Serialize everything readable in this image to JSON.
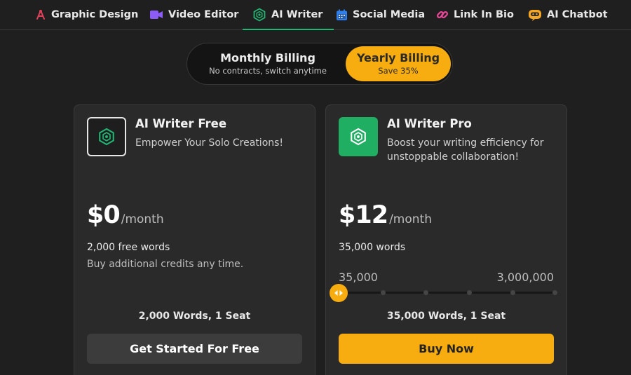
{
  "nav": {
    "items": [
      {
        "label": "Graphic Design",
        "icon": "graphic-design-icon",
        "active": false
      },
      {
        "label": "Video Editor",
        "icon": "video-camera-icon",
        "active": false
      },
      {
        "label": "AI Writer",
        "icon": "ai-writer-icon",
        "active": true
      },
      {
        "label": "Social Media",
        "icon": "calendar-icon",
        "active": false
      },
      {
        "label": "Link In Bio",
        "icon": "link-icon",
        "active": false
      },
      {
        "label": "AI Chatbot",
        "icon": "chatbot-icon",
        "active": false
      }
    ]
  },
  "billing": {
    "monthly": {
      "title": "Monthly Billing",
      "subtitle": "No contracts, switch anytime"
    },
    "yearly": {
      "title": "Yearly Billing",
      "subtitle": "Save 35%"
    },
    "selected": "yearly"
  },
  "plans": {
    "free": {
      "icon": "ai-writer-icon",
      "name": "AI Writer Free",
      "description": "Empower Your Solo Creations!",
      "price": "$0",
      "period": "/month",
      "words": "2,000 free words",
      "note": "Buy additional credits any time.",
      "seats": "2,000 Words, 1 Seat",
      "cta": "Get Started For Free"
    },
    "pro": {
      "icon": "ai-writer-icon",
      "name": "AI Writer Pro",
      "description": "Boost your writing efficiency for unstoppable collaboration!",
      "price": "$12",
      "period": "/month",
      "words": "35,000 words",
      "slider": {
        "min_label": "35,000",
        "max_label": "3,000,000",
        "value_fraction": 0
      },
      "seats": "35,000 Words, 1 Seat",
      "cta": "Buy Now"
    }
  },
  "colors": {
    "accent": "#f7ac0f",
    "active_underline": "#22b573",
    "pro_icon_bg": "#1fae62",
    "background": "#1f1f1f",
    "card": "#2a2a2a"
  }
}
